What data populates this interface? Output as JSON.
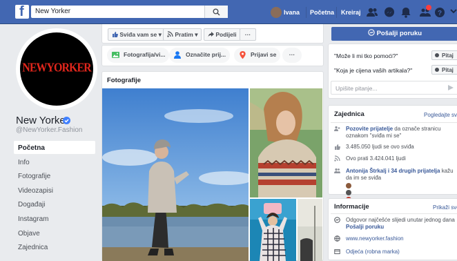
{
  "header": {
    "search_value": "New Yorker",
    "user_name": "Ivana",
    "nav_home": "Početna",
    "nav_create": "Kreiraj"
  },
  "profile": {
    "logo_text": "NEWYORKER",
    "name": "New Yorker",
    "handle": "@NewYorker.Fashion"
  },
  "sidebar": {
    "items": [
      {
        "label": "Početna"
      },
      {
        "label": "Info"
      },
      {
        "label": "Fotografije"
      },
      {
        "label": "Videozapisi"
      },
      {
        "label": "Događaji"
      },
      {
        "label": "Instagram"
      },
      {
        "label": "Objave"
      },
      {
        "label": "Zajednica"
      }
    ]
  },
  "actions": {
    "like": "Sviđa vam se",
    "follow": "Pratim",
    "share": "Podijeli",
    "more": "···"
  },
  "composer": {
    "photo": "Fotografija/vi...",
    "tag": "Označite prij...",
    "checkin": "Prijavi se",
    "more": "···"
  },
  "photos": {
    "title": "Fotografije"
  },
  "messenger": {
    "send_label": "Pošalji poruku",
    "questions": [
      {
        "text": "\"Može li mi tko pomoći?\"",
        "btn": "Pitaj"
      },
      {
        "text": "\"Koja je cijena vaših artikala?\"",
        "btn": "Pitaj"
      }
    ],
    "ask_placeholder": "Upišite pitanje..."
  },
  "community": {
    "title": "Zajednica",
    "see_all": "Pogledajte sve",
    "invite_link": "Pozovite prijatelje",
    "invite_rest": " da označe stranicu oznakom \"sviđa mi se\"",
    "likes": "3.485.050 ljudi se ovo sviđa",
    "follows": "Ovo prati 3.424.041 ljudi",
    "friends_link": "Antonija Štrkalj i 34 drugih prijatelja",
    "friends_rest": " kažu da im se sviđa"
  },
  "info": {
    "title": "Informacije",
    "see_all": "Prikaži sve",
    "response": "Odgovor najčešće slijedi unutar jednog dana",
    "response_link": "Pošalji poruku",
    "website": "www.newyorker.fashion",
    "category": "Odjeća (robna marka)"
  },
  "colors": {
    "brand_blue": "#4267b2",
    "link_blue": "#385898",
    "logo_red": "#e1261c"
  }
}
